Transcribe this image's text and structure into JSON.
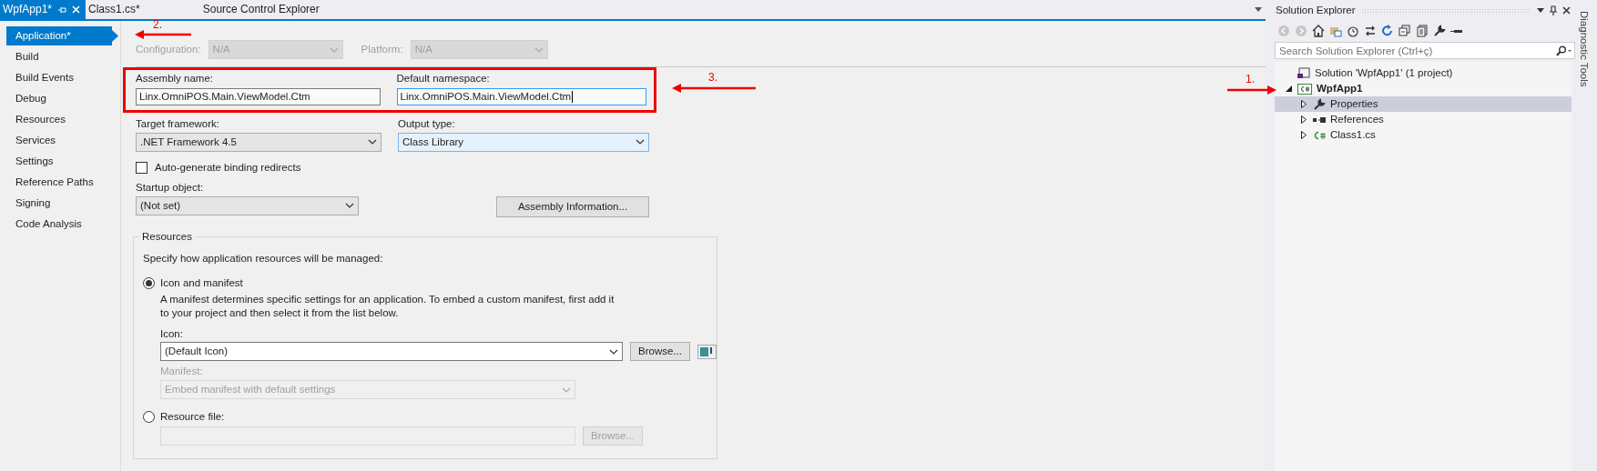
{
  "document_tabs": [
    {
      "label": "WpfApp1*",
      "selected": true
    },
    {
      "label": "Class1.cs*",
      "selected": false
    },
    {
      "label": "Source Control Explorer",
      "selected": false
    }
  ],
  "sidebar": {
    "items": [
      {
        "label": "Application*",
        "selected": true
      },
      {
        "label": "Build",
        "selected": false
      },
      {
        "label": "Build Events",
        "selected": false
      },
      {
        "label": "Debug",
        "selected": false
      },
      {
        "label": "Resources",
        "selected": false
      },
      {
        "label": "Services",
        "selected": false
      },
      {
        "label": "Settings",
        "selected": false
      },
      {
        "label": "Reference Paths",
        "selected": false
      },
      {
        "label": "Signing",
        "selected": false
      },
      {
        "label": "Code Analysis",
        "selected": false
      }
    ]
  },
  "configuration": {
    "label": "Configuration:",
    "value": "N/A",
    "disabled": true
  },
  "platform": {
    "label": "Platform:",
    "value": "N/A",
    "disabled": true
  },
  "assembly_name": {
    "label": "Assembly name:",
    "value": "Linx.OmniPOS.Main.ViewModel.Ctm",
    "focused": false
  },
  "default_namespace": {
    "label": "Default namespace:",
    "value": "Linx.OmniPOS.Main.ViewModel.Ctm",
    "focused": true
  },
  "target_framework": {
    "label": "Target framework:",
    "value": ".NET Framework 4.5",
    "hovered": false
  },
  "output_type": {
    "label": "Output type:",
    "value": "Class Library",
    "hovered": true
  },
  "auto_generate_binding_redirects": {
    "label": "Auto-generate binding redirects",
    "checked": false
  },
  "startup_object": {
    "label": "Startup object:",
    "value": "(Not set)",
    "hovered": false
  },
  "assembly_information_button": "Assembly Information...",
  "resources": {
    "legend": "Resources",
    "hint": "Specify how application resources will be managed:",
    "options": [
      {
        "label": "Icon and manifest",
        "selected": true,
        "description": "A manifest determines specific settings for an application. To embed a custom manifest, first add it to your project and then select it from the list below."
      },
      {
        "label": "Resource file:",
        "selected": false
      }
    ],
    "icon": {
      "label": "Icon:",
      "value": "(Default Icon)"
    },
    "icon_browse": {
      "label": "Browse...",
      "disabled": false
    },
    "manifest": {
      "label": "Manifest:",
      "value": "Embed manifest with default settings",
      "disabled": true
    },
    "resource_file_browse": {
      "label": "Browse...",
      "disabled": true
    }
  },
  "solution_explorer": {
    "title": "Solution Explorer",
    "search_placeholder": "Search Solution Explorer (Ctrl+ç)",
    "tree": [
      {
        "label": "Solution 'WpfApp1' (1 project)",
        "kind": "solution",
        "selected": false,
        "children": [
          {
            "label": "WpfApp1",
            "kind": "project",
            "selected": false,
            "expanded": true,
            "children": [
              {
                "label": "Properties",
                "kind": "properties",
                "selected": true,
                "expanded": false
              },
              {
                "label": "References",
                "kind": "references",
                "selected": false,
                "expanded": false
              },
              {
                "label": "Class1.cs",
                "kind": "csfile",
                "selected": false,
                "expanded": false
              }
            ]
          }
        ]
      }
    ]
  },
  "side_tab": "Diagnostic Tools",
  "annotations": [
    {
      "label": "2."
    },
    {
      "label": "3."
    },
    {
      "label": "1."
    }
  ]
}
